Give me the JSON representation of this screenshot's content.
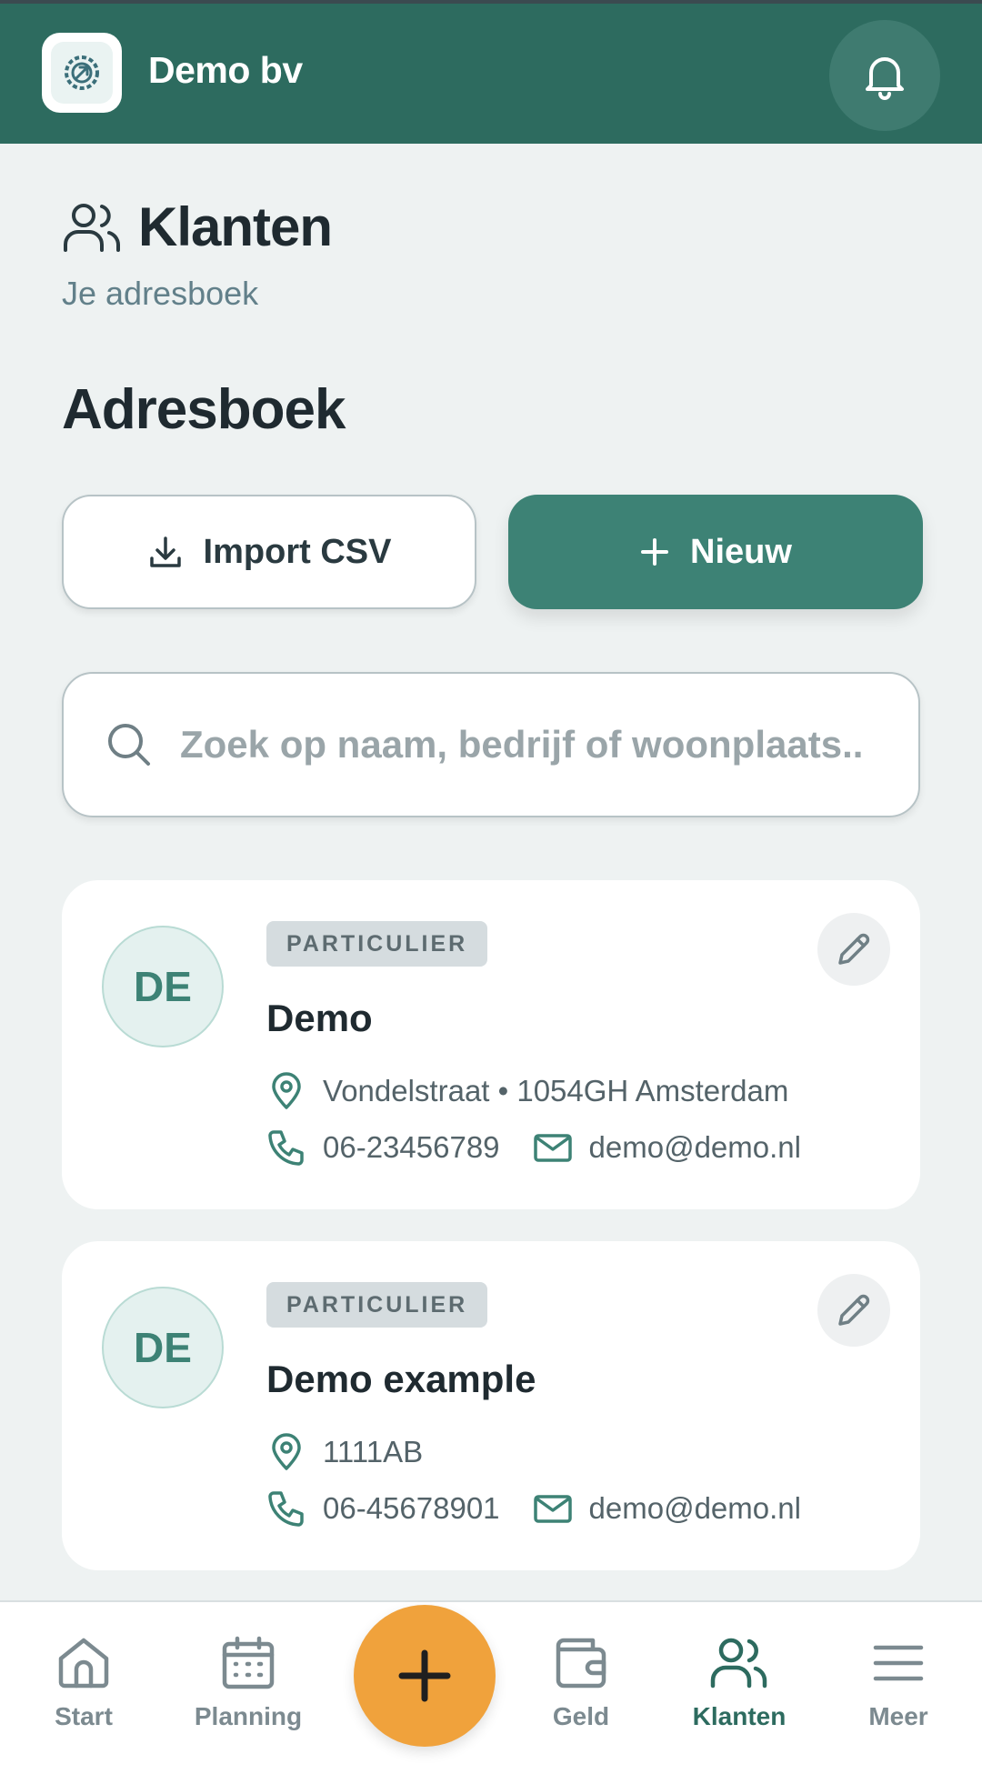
{
  "header": {
    "company_name": "Demo bv"
  },
  "page": {
    "title": "Klanten",
    "subtitle": "Je adresboek"
  },
  "section": {
    "title": "Adresboek"
  },
  "actions": {
    "import_label": "Import CSV",
    "new_label": "Nieuw"
  },
  "search": {
    "placeholder": "Zoek op naam, bedrijf of woonplaats.."
  },
  "customers": [
    {
      "initials": "DE",
      "type": "PARTICULIER",
      "name": "Demo",
      "address": "Vondelstraat • 1054GH Amsterdam",
      "phone": "06-23456789",
      "email": "demo@demo.nl"
    },
    {
      "initials": "DE",
      "type": "PARTICULIER",
      "name": "Demo example",
      "address": "1111AB",
      "phone": "06-45678901",
      "email": "demo@demo.nl"
    }
  ],
  "nav": {
    "items": [
      {
        "label": "Start",
        "icon": "home-icon"
      },
      {
        "label": "Planning",
        "icon": "calendar-icon"
      },
      {
        "label": "Geld",
        "icon": "wallet-icon"
      },
      {
        "label": "Klanten",
        "icon": "users-icon"
      },
      {
        "label": "Meer",
        "icon": "menu-icon"
      }
    ],
    "active": "Klanten"
  },
  "colors": {
    "brand": "#2d6b5f",
    "accent": "#3d8275",
    "fab": "#f0a23c",
    "background": "#eef2f2"
  }
}
